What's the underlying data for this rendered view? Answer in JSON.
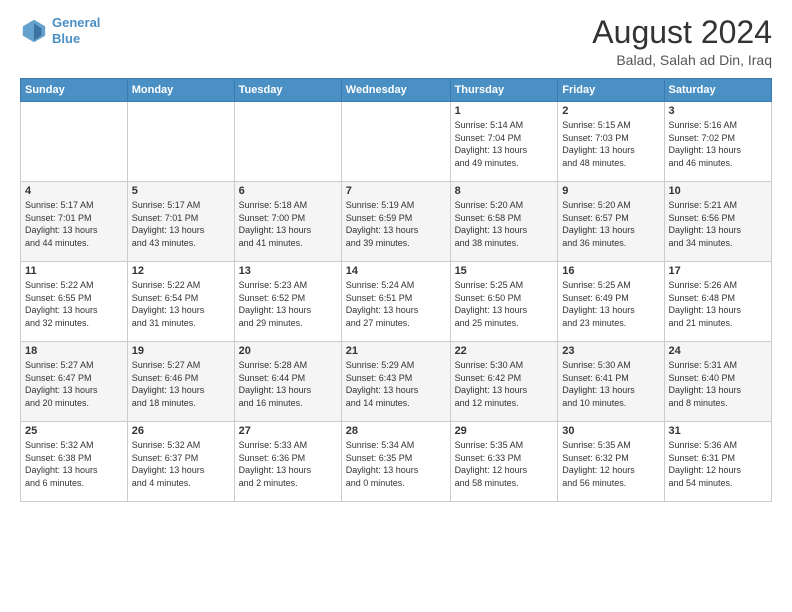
{
  "header": {
    "logo_line1": "General",
    "logo_line2": "Blue",
    "main_title": "August 2024",
    "subtitle": "Balad, Salah ad Din, Iraq"
  },
  "calendar": {
    "days_of_week": [
      "Sunday",
      "Monday",
      "Tuesday",
      "Wednesday",
      "Thursday",
      "Friday",
      "Saturday"
    ],
    "weeks": [
      [
        {
          "day": "",
          "info": ""
        },
        {
          "day": "",
          "info": ""
        },
        {
          "day": "",
          "info": ""
        },
        {
          "day": "",
          "info": ""
        },
        {
          "day": "1",
          "info": "Sunrise: 5:14 AM\nSunset: 7:04 PM\nDaylight: 13 hours\nand 49 minutes."
        },
        {
          "day": "2",
          "info": "Sunrise: 5:15 AM\nSunset: 7:03 PM\nDaylight: 13 hours\nand 48 minutes."
        },
        {
          "day": "3",
          "info": "Sunrise: 5:16 AM\nSunset: 7:02 PM\nDaylight: 13 hours\nand 46 minutes."
        }
      ],
      [
        {
          "day": "4",
          "info": "Sunrise: 5:17 AM\nSunset: 7:01 PM\nDaylight: 13 hours\nand 44 minutes."
        },
        {
          "day": "5",
          "info": "Sunrise: 5:17 AM\nSunset: 7:01 PM\nDaylight: 13 hours\nand 43 minutes."
        },
        {
          "day": "6",
          "info": "Sunrise: 5:18 AM\nSunset: 7:00 PM\nDaylight: 13 hours\nand 41 minutes."
        },
        {
          "day": "7",
          "info": "Sunrise: 5:19 AM\nSunset: 6:59 PM\nDaylight: 13 hours\nand 39 minutes."
        },
        {
          "day": "8",
          "info": "Sunrise: 5:20 AM\nSunset: 6:58 PM\nDaylight: 13 hours\nand 38 minutes."
        },
        {
          "day": "9",
          "info": "Sunrise: 5:20 AM\nSunset: 6:57 PM\nDaylight: 13 hours\nand 36 minutes."
        },
        {
          "day": "10",
          "info": "Sunrise: 5:21 AM\nSunset: 6:56 PM\nDaylight: 13 hours\nand 34 minutes."
        }
      ],
      [
        {
          "day": "11",
          "info": "Sunrise: 5:22 AM\nSunset: 6:55 PM\nDaylight: 13 hours\nand 32 minutes."
        },
        {
          "day": "12",
          "info": "Sunrise: 5:22 AM\nSunset: 6:54 PM\nDaylight: 13 hours\nand 31 minutes."
        },
        {
          "day": "13",
          "info": "Sunrise: 5:23 AM\nSunset: 6:52 PM\nDaylight: 13 hours\nand 29 minutes."
        },
        {
          "day": "14",
          "info": "Sunrise: 5:24 AM\nSunset: 6:51 PM\nDaylight: 13 hours\nand 27 minutes."
        },
        {
          "day": "15",
          "info": "Sunrise: 5:25 AM\nSunset: 6:50 PM\nDaylight: 13 hours\nand 25 minutes."
        },
        {
          "day": "16",
          "info": "Sunrise: 5:25 AM\nSunset: 6:49 PM\nDaylight: 13 hours\nand 23 minutes."
        },
        {
          "day": "17",
          "info": "Sunrise: 5:26 AM\nSunset: 6:48 PM\nDaylight: 13 hours\nand 21 minutes."
        }
      ],
      [
        {
          "day": "18",
          "info": "Sunrise: 5:27 AM\nSunset: 6:47 PM\nDaylight: 13 hours\nand 20 minutes."
        },
        {
          "day": "19",
          "info": "Sunrise: 5:27 AM\nSunset: 6:46 PM\nDaylight: 13 hours\nand 18 minutes."
        },
        {
          "day": "20",
          "info": "Sunrise: 5:28 AM\nSunset: 6:44 PM\nDaylight: 13 hours\nand 16 minutes."
        },
        {
          "day": "21",
          "info": "Sunrise: 5:29 AM\nSunset: 6:43 PM\nDaylight: 13 hours\nand 14 minutes."
        },
        {
          "day": "22",
          "info": "Sunrise: 5:30 AM\nSunset: 6:42 PM\nDaylight: 13 hours\nand 12 minutes."
        },
        {
          "day": "23",
          "info": "Sunrise: 5:30 AM\nSunset: 6:41 PM\nDaylight: 13 hours\nand 10 minutes."
        },
        {
          "day": "24",
          "info": "Sunrise: 5:31 AM\nSunset: 6:40 PM\nDaylight: 13 hours\nand 8 minutes."
        }
      ],
      [
        {
          "day": "25",
          "info": "Sunrise: 5:32 AM\nSunset: 6:38 PM\nDaylight: 13 hours\nand 6 minutes."
        },
        {
          "day": "26",
          "info": "Sunrise: 5:32 AM\nSunset: 6:37 PM\nDaylight: 13 hours\nand 4 minutes."
        },
        {
          "day": "27",
          "info": "Sunrise: 5:33 AM\nSunset: 6:36 PM\nDaylight: 13 hours\nand 2 minutes."
        },
        {
          "day": "28",
          "info": "Sunrise: 5:34 AM\nSunset: 6:35 PM\nDaylight: 13 hours\nand 0 minutes."
        },
        {
          "day": "29",
          "info": "Sunrise: 5:35 AM\nSunset: 6:33 PM\nDaylight: 12 hours\nand 58 minutes."
        },
        {
          "day": "30",
          "info": "Sunrise: 5:35 AM\nSunset: 6:32 PM\nDaylight: 12 hours\nand 56 minutes."
        },
        {
          "day": "31",
          "info": "Sunrise: 5:36 AM\nSunset: 6:31 PM\nDaylight: 12 hours\nand 54 minutes."
        }
      ]
    ]
  }
}
